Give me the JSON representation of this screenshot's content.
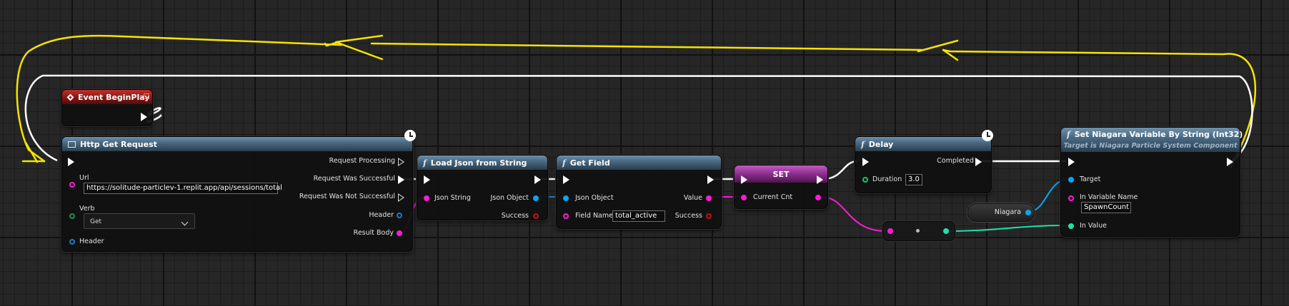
{
  "nodes": {
    "event_begin_play": {
      "title": "Event BeginPlay"
    },
    "http_get": {
      "title": "Http Get Request",
      "url_label": "Url",
      "url_value": "https://solitude-particlev-1.replit.app/api/sessions/total",
      "verb_label": "Verb",
      "verb_value": "Get",
      "header_in_label": "Header",
      "out_processing": "Request Processing",
      "out_successful": "Request Was Successful",
      "out_not_successful": "Request Was Not Successful",
      "out_header": "Header",
      "out_result_body": "Result Body"
    },
    "load_json": {
      "title": "Load Json from String",
      "in_json_string": "Json String",
      "out_json_object": "Json Object",
      "out_success": "Success"
    },
    "get_field": {
      "title": "Get Field",
      "in_json_object": "Json Object",
      "in_field_name": "Field Name",
      "field_name_value": "total_active",
      "out_value": "Value",
      "out_success": "Success"
    },
    "set_node": {
      "title": "SET",
      "pin_current_cnt": "Current Cnt"
    },
    "delay": {
      "title": "Delay",
      "out_completed": "Completed",
      "in_duration": "Duration",
      "duration_value": "3.0"
    },
    "niagara_var": {
      "label": "Niagara"
    },
    "set_niagara": {
      "title": "Set Niagara Variable By String (Int32)",
      "subtitle": "Target is Niagara Particle System Component",
      "in_target": "Target",
      "in_variable_name": "In Variable Name",
      "variable_name_value": "SpawnCount",
      "in_value": "In Value"
    }
  },
  "icons": {
    "function": "function-icon",
    "event": "event-icon",
    "latent": "clock-icon",
    "web": "window-icon"
  },
  "colors": {
    "exec_wire": "#ffffff",
    "string_pin": "#ff1ad9",
    "object_pin": "#00a8f5",
    "bool_pin": "#c01010",
    "float_pin": "#11c96b",
    "int_pin": "#1fe0a8",
    "annotation": "#f5e400",
    "header_blue": "#4a6a84",
    "header_red": "#8a1a17",
    "header_pink": "#8c2c8c"
  }
}
